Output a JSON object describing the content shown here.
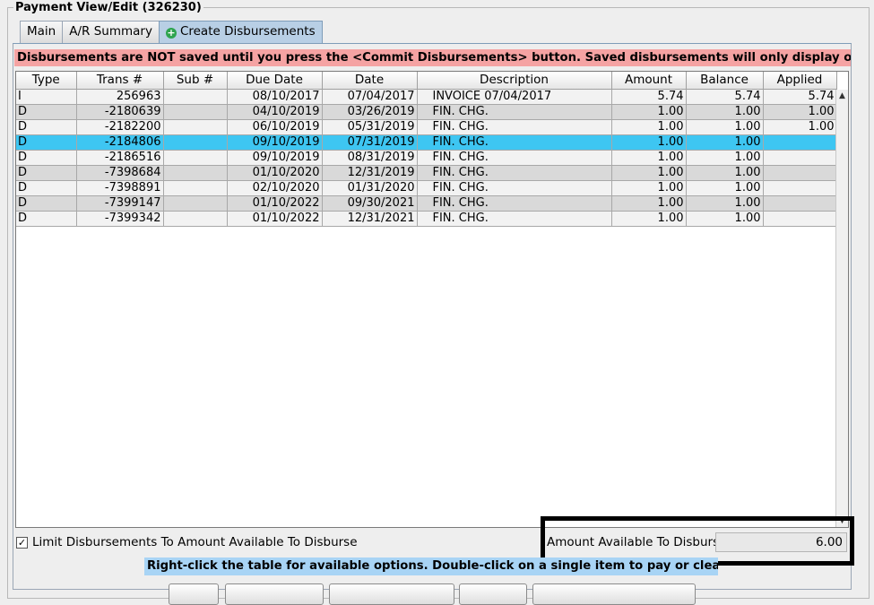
{
  "panel": {
    "title": "Payment View/Edit  (326230)"
  },
  "tabs": [
    {
      "label": "Main"
    },
    {
      "label": "A/R Summary"
    },
    {
      "label": "Create Disbursements",
      "icon": "plus-circle-icon",
      "active": true
    }
  ],
  "warning": "Disbursements are NOT saved until you press the <Commit Disbursements> button. Saved disbursements will only display on the Main Tab.",
  "table": {
    "columns": [
      "Type",
      "Trans #",
      "Sub #",
      "Due Date",
      "Date",
      "Description",
      "Amount",
      "Balance",
      "Applied"
    ],
    "rows": [
      {
        "type": "I",
        "trans": "256963",
        "sub": "",
        "due": "08/10/2017",
        "date": "07/04/2017",
        "desc": "INVOICE 07/04/2017",
        "amount": "5.74",
        "balance": "5.74",
        "applied": "5.74"
      },
      {
        "type": "D",
        "trans": "-2180639",
        "sub": "",
        "due": "04/10/2019",
        "date": "03/26/2019",
        "desc": "FIN. CHG.",
        "amount": "1.00",
        "balance": "1.00",
        "applied": "1.00"
      },
      {
        "type": "D",
        "trans": "-2182200",
        "sub": "",
        "due": "06/10/2019",
        "date": "05/31/2019",
        "desc": "FIN. CHG.",
        "amount": "1.00",
        "balance": "1.00",
        "applied": "1.00"
      },
      {
        "type": "D",
        "trans": "-2184806",
        "sub": "",
        "due": "09/10/2019",
        "date": "07/31/2019",
        "desc": "FIN. CHG.",
        "amount": "1.00",
        "balance": "1.00",
        "applied": "",
        "selected": true
      },
      {
        "type": "D",
        "trans": "-2186516",
        "sub": "",
        "due": "09/10/2019",
        "date": "08/31/2019",
        "desc": "FIN. CHG.",
        "amount": "1.00",
        "balance": "1.00",
        "applied": ""
      },
      {
        "type": "D",
        "trans": "-7398684",
        "sub": "",
        "due": "01/10/2020",
        "date": "12/31/2019",
        "desc": "FIN. CHG.",
        "amount": "1.00",
        "balance": "1.00",
        "applied": ""
      },
      {
        "type": "D",
        "trans": "-7398891",
        "sub": "",
        "due": "02/10/2020",
        "date": "01/31/2020",
        "desc": "FIN. CHG.",
        "amount": "1.00",
        "balance": "1.00",
        "applied": ""
      },
      {
        "type": "D",
        "trans": "-7399147",
        "sub": "",
        "due": "01/10/2022",
        "date": "09/30/2021",
        "desc": "FIN. CHG.",
        "amount": "1.00",
        "balance": "1.00",
        "applied": ""
      },
      {
        "type": "D",
        "trans": "-7399342",
        "sub": "",
        "due": "01/10/2022",
        "date": "12/31/2021",
        "desc": "FIN. CHG.",
        "amount": "1.00",
        "balance": "1.00",
        "applied": ""
      }
    ]
  },
  "limit": {
    "label": "Limit Disbursements To Amount Available To Disburse",
    "checked": true,
    "check_glyph": "✓"
  },
  "available": {
    "label": "Amount Available To Disburse",
    "value": "6.00"
  },
  "hint": "Right-click the table for available options. Double-click on a single item to pay or clear that item.",
  "scroll": {
    "up_glyph": "▲",
    "down_glyph": "▼"
  },
  "colors": {
    "warning_bg": "#f5a3a3",
    "selected_row": "#3ec6f2",
    "hint_bg": "#a8d4f5",
    "active_tab": "#b8cfe5"
  }
}
